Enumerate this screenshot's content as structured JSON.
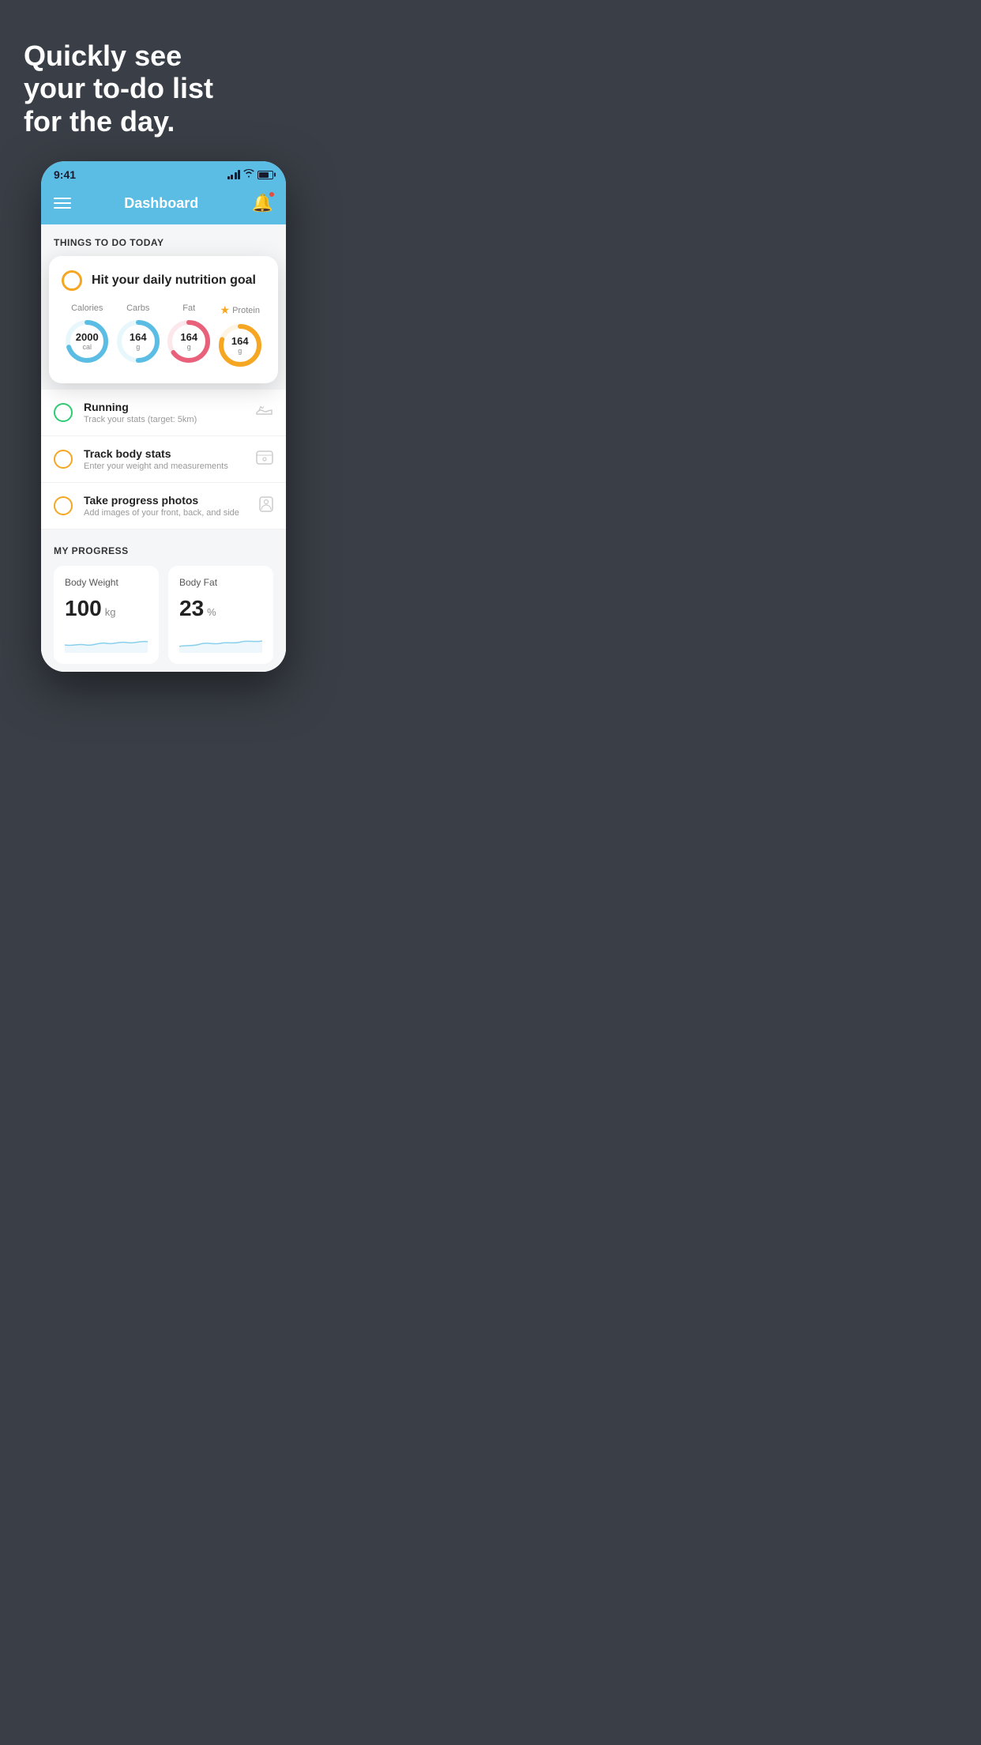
{
  "background": {
    "color": "#3a3f47"
  },
  "hero": {
    "line1": "Quickly see",
    "line2": "your to-do list",
    "line3": "for the day."
  },
  "phone": {
    "status_bar": {
      "time": "9:41"
    },
    "header": {
      "title": "Dashboard",
      "menu_label": "menu",
      "bell_label": "notifications"
    },
    "things_section": {
      "heading": "THINGS TO DO TODAY"
    },
    "nutrition_card": {
      "title": "Hit your daily nutrition goal",
      "items": [
        {
          "label": "Calories",
          "value": "2000",
          "unit": "cal",
          "color": "#5bbde4",
          "track_color": "#e8f7fc",
          "pct": 70
        },
        {
          "label": "Carbs",
          "value": "164",
          "unit": "g",
          "color": "#5bbde4",
          "track_color": "#e8f7fc",
          "pct": 50
        },
        {
          "label": "Fat",
          "value": "164",
          "unit": "g",
          "color": "#e8607a",
          "track_color": "#fce8ec",
          "pct": 65
        },
        {
          "label": "Protein",
          "value": "164",
          "unit": "g",
          "color": "#f5a623",
          "track_color": "#fef4e3",
          "pct": 80,
          "starred": true
        }
      ]
    },
    "todo_items": [
      {
        "title": "Running",
        "subtitle": "Track your stats (target: 5km)",
        "status": "green",
        "icon": "shoe"
      },
      {
        "title": "Track body stats",
        "subtitle": "Enter your weight and measurements",
        "status": "yellow",
        "icon": "scale"
      },
      {
        "title": "Take progress photos",
        "subtitle": "Add images of your front, back, and side",
        "status": "yellow",
        "icon": "person"
      }
    ],
    "progress_section": {
      "heading": "MY PROGRESS",
      "cards": [
        {
          "title": "Body Weight",
          "value": "100",
          "unit": "kg"
        },
        {
          "title": "Body Fat",
          "value": "23",
          "unit": "%"
        }
      ]
    }
  }
}
